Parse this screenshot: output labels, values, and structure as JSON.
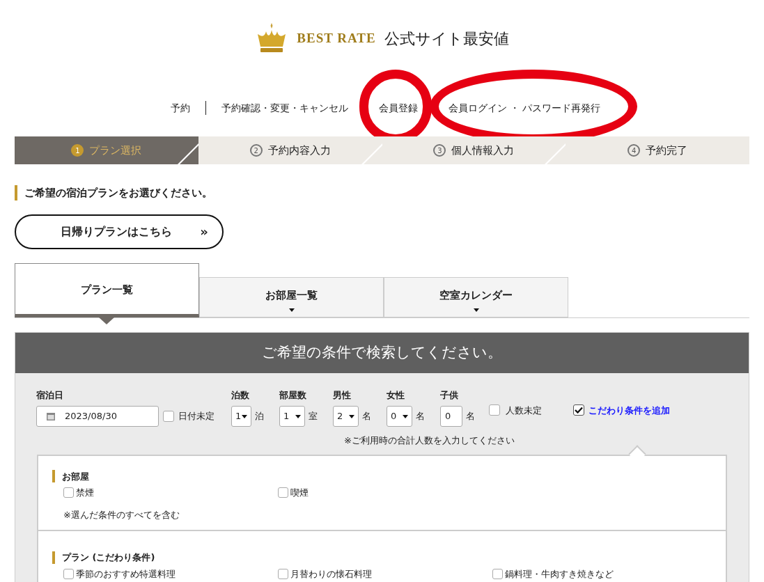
{
  "logo": {
    "brand": "BEST RATE",
    "tagline": "公式サイト最安値"
  },
  "nav": [
    {
      "label": "予約",
      "divider": true
    },
    {
      "label": "予約確認・変更・キャンセル",
      "divider": false
    },
    {
      "label": "会員登録",
      "divider": false
    },
    {
      "label": "会員ログイン ・ パスワード再発行",
      "divider": false
    }
  ],
  "annotations": [
    {
      "kind": "circle",
      "color": "#e60012"
    },
    {
      "kind": "ellipse",
      "color": "#e60012"
    }
  ],
  "steps": [
    {
      "number": "1",
      "label": "プラン選択",
      "selected": true
    },
    {
      "number": "2",
      "label": "予約内容入力",
      "selected": false
    },
    {
      "number": "3",
      "label": "個人情報入力",
      "selected": false
    },
    {
      "number": "4",
      "label": "予約完了",
      "selected": false
    }
  ],
  "heading": "ご希望の宿泊プランをお選びください。",
  "day_trip_button": {
    "label": "日帰りプランはこちら",
    "icon": "»"
  },
  "tabs": [
    {
      "label": "プラン一覧",
      "selected": true
    },
    {
      "label": "お部屋一覧",
      "selected": false
    },
    {
      "label": "空室カレンダー",
      "selected": false
    }
  ],
  "search": {
    "title": "ご希望の条件で検索してください。",
    "date": {
      "label": "宿泊日",
      "value": "2023/08/30"
    },
    "date_undecided": {
      "label": "日付未定",
      "checked": false
    },
    "counts": [
      {
        "kind": "select",
        "label": "泊数",
        "value": "1",
        "unit": "泊"
      },
      {
        "kind": "select",
        "label": "部屋数",
        "value": "1",
        "unit": "室"
      },
      {
        "kind": "select",
        "label": "男性",
        "value": "2",
        "unit": "名"
      },
      {
        "kind": "select",
        "label": "女性",
        "value": "0",
        "unit": "名"
      },
      {
        "kind": "input",
        "label": "子供",
        "value": "0",
        "unit": "名"
      }
    ],
    "people_undecided": {
      "label": "人数未定",
      "checked": false
    },
    "add_conditions": {
      "label": "こだわり条件を追加",
      "checked": true
    },
    "note": "※ご利用時の合計人数を入力してください",
    "sections": [
      {
        "title": "お部屋",
        "options": [
          {
            "label": "禁煙",
            "checked": false
          },
          {
            "label": "喫煙",
            "checked": false
          }
        ],
        "note": "※選んだ条件のすべてを含む"
      },
      {
        "title": "プラン (こだわり条件)",
        "options": [
          {
            "label": "季節のおすすめ特選料理",
            "checked": false
          },
          {
            "label": "月替わりの懐石料理",
            "checked": false
          },
          {
            "label": "鍋料理・牛肉すき焼きなど",
            "checked": false
          }
        ]
      }
    ]
  }
}
